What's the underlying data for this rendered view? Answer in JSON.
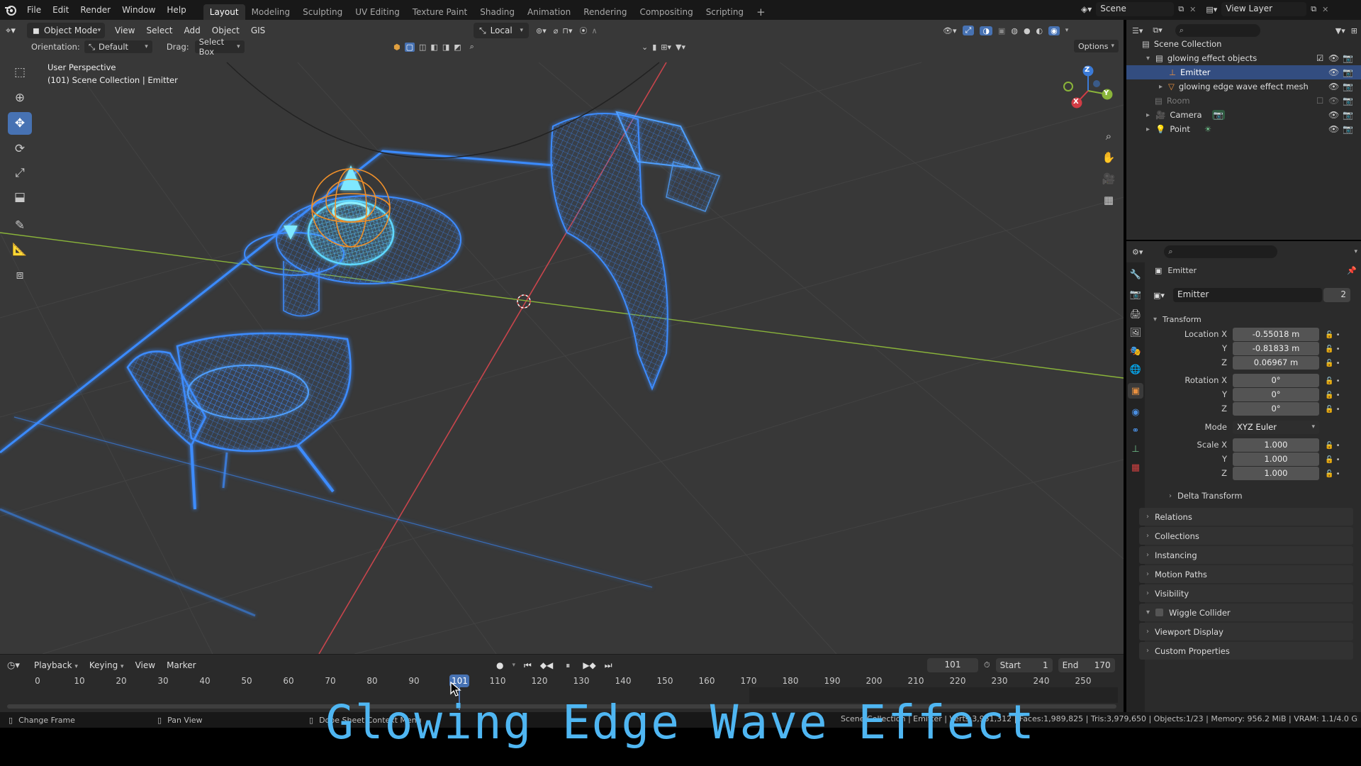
{
  "app": {
    "menus": [
      "File",
      "Edit",
      "Render",
      "Window",
      "Help"
    ],
    "workspaces": [
      "Layout",
      "Modeling",
      "Sculpting",
      "UV Editing",
      "Texture Paint",
      "Shading",
      "Animation",
      "Rendering",
      "Compositing",
      "Scripting"
    ],
    "active_workspace": "Layout",
    "scene_name": "Scene",
    "view_layer": "View Layer"
  },
  "viewport": {
    "mode": "Object Mode",
    "menus": [
      "View",
      "Select",
      "Add",
      "Object",
      "GIS"
    ],
    "transform_orientation": "Local",
    "orientation_label": "Orientation:",
    "orientation_value": "Default",
    "drag_label": "Drag:",
    "drag_value": "Select Box",
    "options_label": "Options",
    "overlay_title": "User Perspective",
    "overlay_subtitle": "(101) Scene Collection | Emitter",
    "tools": [
      "select-box-icon",
      "cursor-icon",
      "move-icon",
      "rotate-icon",
      "scale-icon",
      "transform-icon",
      "annotate-icon",
      "measure-icon",
      "add-cube-icon"
    ],
    "active_tool": "move-icon",
    "gizmo": {
      "x": "X",
      "y": "Y",
      "z": "Z"
    }
  },
  "timeline": {
    "menus": [
      "Playback",
      "Keying",
      "View",
      "Marker"
    ],
    "current_frame": "101",
    "start_label": "Start",
    "start": "1",
    "end_label": "End",
    "end": "170",
    "ticks": [
      "0",
      "10",
      "20",
      "30",
      "40",
      "50",
      "60",
      "70",
      "80",
      "90",
      "101",
      "110",
      "120",
      "130",
      "140",
      "150",
      "160",
      "170",
      "180",
      "190",
      "200",
      "210",
      "220",
      "230",
      "240",
      "250"
    ]
  },
  "outliner": {
    "root": "Scene Collection",
    "items": [
      {
        "label": "glowing effect objects",
        "indent": 1
      },
      {
        "label": "Emitter",
        "indent": 2
      },
      {
        "label": "glowing edge wave effect mesh",
        "indent": 2
      },
      {
        "label": "Room",
        "indent": 1
      },
      {
        "label": "Camera",
        "indent": 1
      },
      {
        "label": "Point",
        "indent": 1
      }
    ]
  },
  "properties": {
    "object_name": "Emitter",
    "data_name": "Emitter",
    "user_count": "2",
    "transform_header": "Transform",
    "location_label": "Location X",
    "location": [
      "-0.55018 m",
      "-0.81833 m",
      "0.06967 m"
    ],
    "rotation_label": "Rotation X",
    "rotation": [
      "0°",
      "0°",
      "0°"
    ],
    "axis_y": "Y",
    "axis_z": "Z",
    "mode_label": "Mode",
    "mode_value": "XYZ Euler",
    "scale_label": "Scale X",
    "scale": [
      "1.000",
      "1.000",
      "1.000"
    ],
    "delta_transform": "Delta Transform",
    "panels": [
      "Relations",
      "Collections",
      "Instancing",
      "Motion Paths",
      "Visibility",
      "Wiggle Collider",
      "Viewport Display",
      "Custom Properties"
    ]
  },
  "statusbar": {
    "left1": "Change Frame",
    "left2": "Pan View",
    "left3": "Dope Sheet Context Menu",
    "right": "Scene Collection | Emitter | Verts:3,951,312 | Faces:1,989,825 | Tris:3,979,650 | Objects:1/23 | Memory: 956.2 MiB | VRAM: 1.1/4.0 GiB | 3.5.1"
  },
  "caption": "Glowing Edge Wave Effect",
  "colors": {
    "accent": "#4772b3",
    "glow": "#3aa0ff",
    "caption": "#4fb6f2",
    "x_axis": "#c8454c",
    "y_axis": "#8ab43a"
  }
}
